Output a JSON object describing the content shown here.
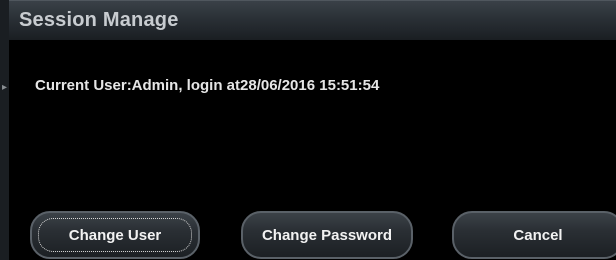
{
  "window": {
    "title": "Session Manage"
  },
  "session": {
    "info_text": "Current User:Admin,  login at28/06/2016 15:51:54"
  },
  "buttons": {
    "change_user": "Change User",
    "change_password": "Change Password",
    "cancel": "Cancel"
  },
  "colors": {
    "background": "#000000",
    "title_bar": "#2a3036",
    "title_text": "#c8ccd0",
    "body_text": "#e6e6e6",
    "button_border": "#5a6168"
  }
}
